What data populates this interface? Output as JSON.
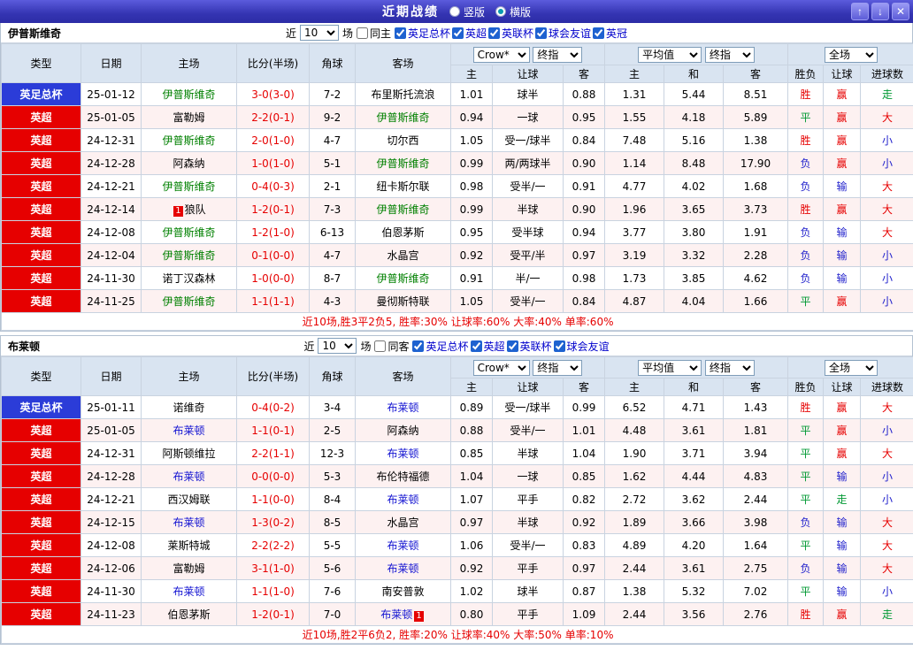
{
  "window": {
    "title": "近期战绩",
    "layout_radios": {
      "vertical": "竖版",
      "horizontal": "横版",
      "selected": "横版"
    }
  },
  "icons": {
    "up": "↑",
    "down": "↓",
    "close": "✕"
  },
  "filter_labels": {
    "near": "近",
    "games": "场"
  },
  "columns": {
    "type": "类型",
    "date": "日期",
    "home": "主场",
    "score": "比分(半场)",
    "corner": "角球",
    "away": "客场",
    "odds_home": "主",
    "handicap": "让球",
    "odds_away": "客",
    "avg_home": "主",
    "avg_draw": "和",
    "avg_away": "客",
    "result": "胜负",
    "handicap_result": "让球",
    "goals": "进球数"
  },
  "selects": {
    "bookmaker": "Crow*",
    "odds_time": "终指",
    "average": "平均值",
    "avg_time": "终指",
    "scope": "全场"
  },
  "type_colors": {
    "英足总杯": "#2b3cd8",
    "英超": "#e60000"
  },
  "result_colors": {
    "胜": "#e60000",
    "赢": "#e60000",
    "大": "#e60000",
    "平": "#009933",
    "走": "#009933",
    "负": "#2222cc",
    "输": "#2222cc",
    "小": "#2222cc"
  },
  "sections": [
    {
      "team": "伊普斯维奇",
      "team_color": "#008000",
      "count": "10",
      "same_label": "同主",
      "leagues": [
        "英足总杯",
        "英超",
        "英联杯",
        "球会友谊",
        "英冠"
      ],
      "summary": "近10场,胜3平2负5, 胜率:30% 让球率:60% 大率:40% 单率:60%",
      "rows": [
        {
          "type": "英足总杯",
          "date": "25-01-12",
          "home": "伊普斯维奇",
          "home_is_team": true,
          "score": "3-0(3-0)",
          "corner": "7-2",
          "away": "布里斯托流浪",
          "odds_home": "1.01",
          "handicap": "球半",
          "odds_away": "0.88",
          "avg_home": "1.31",
          "avg_draw": "5.44",
          "avg_away": "8.51",
          "result": "胜",
          "handicap_result": "赢",
          "goals_result": "走"
        },
        {
          "type": "英超",
          "date": "25-01-05",
          "home": "富勒姆",
          "score": "2-2(0-1)",
          "corner": "9-2",
          "away": "伊普斯维奇",
          "away_is_team": true,
          "odds_home": "0.94",
          "handicap": "一球",
          "odds_away": "0.95",
          "avg_home": "1.55",
          "avg_draw": "4.18",
          "avg_away": "5.89",
          "result": "平",
          "handicap_result": "赢",
          "goals_result": "大"
        },
        {
          "type": "英超",
          "date": "24-12-31",
          "home": "伊普斯维奇",
          "home_is_team": true,
          "score": "2-0(1-0)",
          "corner": "4-7",
          "away": "切尔西",
          "odds_home": "1.05",
          "handicap": "受一/球半",
          "odds_away": "0.84",
          "avg_home": "7.48",
          "avg_draw": "5.16",
          "avg_away": "1.38",
          "result": "胜",
          "handicap_result": "赢",
          "goals_result": "小"
        },
        {
          "type": "英超",
          "date": "24-12-28",
          "home": "阿森纳",
          "score": "1-0(1-0)",
          "corner": "5-1",
          "away": "伊普斯维奇",
          "away_is_team": true,
          "odds_home": "0.99",
          "handicap": "两/两球半",
          "odds_away": "0.90",
          "avg_home": "1.14",
          "avg_draw": "8.48",
          "avg_away": "17.90",
          "result": "负",
          "handicap_result": "赢",
          "goals_result": "小"
        },
        {
          "type": "英超",
          "date": "24-12-21",
          "home": "伊普斯维奇",
          "home_is_team": true,
          "score": "0-4(0-3)",
          "corner": "2-1",
          "away": "纽卡斯尔联",
          "odds_home": "0.98",
          "handicap": "受半/一",
          "odds_away": "0.91",
          "avg_home": "4.77",
          "avg_draw": "4.02",
          "avg_away": "1.68",
          "result": "负",
          "handicap_result": "输",
          "goals_result": "大"
        },
        {
          "type": "英超",
          "date": "24-12-14",
          "home": "狼队",
          "home_badge": "1",
          "score": "1-2(0-1)",
          "corner": "7-3",
          "away": "伊普斯维奇",
          "away_is_team": true,
          "odds_home": "0.99",
          "handicap": "半球",
          "odds_away": "0.90",
          "avg_home": "1.96",
          "avg_draw": "3.65",
          "avg_away": "3.73",
          "result": "胜",
          "handicap_result": "赢",
          "goals_result": "大"
        },
        {
          "type": "英超",
          "date": "24-12-08",
          "home": "伊普斯维奇",
          "home_is_team": true,
          "score": "1-2(1-0)",
          "corner": "6-13",
          "away": "伯恩茅斯",
          "odds_home": "0.95",
          "handicap": "受半球",
          "odds_away": "0.94",
          "avg_home": "3.77",
          "avg_draw": "3.80",
          "avg_away": "1.91",
          "result": "负",
          "handicap_result": "输",
          "goals_result": "大"
        },
        {
          "type": "英超",
          "date": "24-12-04",
          "home": "伊普斯维奇",
          "home_is_team": true,
          "score": "0-1(0-0)",
          "corner": "4-7",
          "away": "水晶宫",
          "odds_home": "0.92",
          "handicap": "受平/半",
          "odds_away": "0.97",
          "avg_home": "3.19",
          "avg_draw": "3.32",
          "avg_away": "2.28",
          "result": "负",
          "handicap_result": "输",
          "goals_result": "小"
        },
        {
          "type": "英超",
          "date": "24-11-30",
          "home": "诺丁汉森林",
          "score": "1-0(0-0)",
          "corner": "8-7",
          "away": "伊普斯维奇",
          "away_is_team": true,
          "odds_home": "0.91",
          "handicap": "半/一",
          "odds_away": "0.98",
          "avg_home": "1.73",
          "avg_draw": "3.85",
          "avg_away": "4.62",
          "result": "负",
          "handicap_result": "输",
          "goals_result": "小"
        },
        {
          "type": "英超",
          "date": "24-11-25",
          "home": "伊普斯维奇",
          "home_is_team": true,
          "score": "1-1(1-1)",
          "corner": "4-3",
          "away": "曼彻斯特联",
          "odds_home": "1.05",
          "handicap": "受半/一",
          "odds_away": "0.84",
          "avg_home": "4.87",
          "avg_draw": "4.04",
          "avg_away": "1.66",
          "result": "平",
          "handicap_result": "赢",
          "goals_result": "小"
        }
      ]
    },
    {
      "team": "布莱顿",
      "team_color": "#1414d2",
      "count": "10",
      "same_label": "同客",
      "leagues": [
        "英足总杯",
        "英超",
        "英联杯",
        "球会友谊"
      ],
      "summary": "近10场,胜2平6负2, 胜率:20% 让球率:40% 大率:50% 单率:10%",
      "rows": [
        {
          "type": "英足总杯",
          "date": "25-01-11",
          "home": "诺维奇",
          "score": "0-4(0-2)",
          "corner": "3-4",
          "away": "布莱顿",
          "away_is_team": true,
          "odds_home": "0.89",
          "handicap": "受一/球半",
          "odds_away": "0.99",
          "avg_home": "6.52",
          "avg_draw": "4.71",
          "avg_away": "1.43",
          "result": "胜",
          "handicap_result": "赢",
          "goals_result": "大"
        },
        {
          "type": "英超",
          "date": "25-01-05",
          "home": "布莱顿",
          "home_is_team": true,
          "score": "1-1(0-1)",
          "corner": "2-5",
          "away": "阿森纳",
          "odds_home": "0.88",
          "handicap": "受半/一",
          "odds_away": "1.01",
          "avg_home": "4.48",
          "avg_draw": "3.61",
          "avg_away": "1.81",
          "result": "平",
          "handicap_result": "赢",
          "goals_result": "小"
        },
        {
          "type": "英超",
          "date": "24-12-31",
          "home": "阿斯顿维拉",
          "score": "2-2(1-1)",
          "corner": "12-3",
          "away": "布莱顿",
          "away_is_team": true,
          "odds_home": "0.85",
          "handicap": "半球",
          "odds_away": "1.04",
          "avg_home": "1.90",
          "avg_draw": "3.71",
          "avg_away": "3.94",
          "result": "平",
          "handicap_result": "赢",
          "goals_result": "大"
        },
        {
          "type": "英超",
          "date": "24-12-28",
          "home": "布莱顿",
          "home_is_team": true,
          "score": "0-0(0-0)",
          "corner": "5-3",
          "away": "布伦特福德",
          "odds_home": "1.04",
          "handicap": "一球",
          "odds_away": "0.85",
          "avg_home": "1.62",
          "avg_draw": "4.44",
          "avg_away": "4.83",
          "result": "平",
          "handicap_result": "输",
          "goals_result": "小"
        },
        {
          "type": "英超",
          "date": "24-12-21",
          "home": "西汉姆联",
          "score": "1-1(0-0)",
          "corner": "8-4",
          "away": "布莱顿",
          "away_is_team": true,
          "odds_home": "1.07",
          "handicap": "平手",
          "odds_away": "0.82",
          "avg_home": "2.72",
          "avg_draw": "3.62",
          "avg_away": "2.44",
          "result": "平",
          "handicap_result": "走",
          "goals_result": "小"
        },
        {
          "type": "英超",
          "date": "24-12-15",
          "home": "布莱顿",
          "home_is_team": true,
          "score": "1-3(0-2)",
          "corner": "8-5",
          "away": "水晶宫",
          "odds_home": "0.97",
          "handicap": "半球",
          "odds_away": "0.92",
          "avg_home": "1.89",
          "avg_draw": "3.66",
          "avg_away": "3.98",
          "result": "负",
          "handicap_result": "输",
          "goals_result": "大"
        },
        {
          "type": "英超",
          "date": "24-12-08",
          "home": "莱斯特城",
          "score": "2-2(2-2)",
          "corner": "5-5",
          "away": "布莱顿",
          "away_is_team": true,
          "odds_home": "1.06",
          "handicap": "受半/一",
          "odds_away": "0.83",
          "avg_home": "4.89",
          "avg_draw": "4.20",
          "avg_away": "1.64",
          "result": "平",
          "handicap_result": "输",
          "goals_result": "大"
        },
        {
          "type": "英超",
          "date": "24-12-06",
          "home": "富勒姆",
          "score": "3-1(1-0)",
          "corner": "5-6",
          "away": "布莱顿",
          "away_is_team": true,
          "odds_home": "0.92",
          "handicap": "平手",
          "odds_away": "0.97",
          "avg_home": "2.44",
          "avg_draw": "3.61",
          "avg_away": "2.75",
          "result": "负",
          "handicap_result": "输",
          "goals_result": "大"
        },
        {
          "type": "英超",
          "date": "24-11-30",
          "home": "布莱顿",
          "home_is_team": true,
          "score": "1-1(1-0)",
          "corner": "7-6",
          "away": "南安普敦",
          "odds_home": "1.02",
          "handicap": "球半",
          "odds_away": "0.87",
          "avg_home": "1.38",
          "avg_draw": "5.32",
          "avg_away": "7.02",
          "result": "平",
          "handicap_result": "输",
          "goals_result": "小"
        },
        {
          "type": "英超",
          "date": "24-11-23",
          "home": "伯恩茅斯",
          "score": "1-2(0-1)",
          "corner": "7-0",
          "away": "布莱顿",
          "away_is_team": true,
          "away_badge": "1",
          "odds_home": "0.80",
          "handicap": "平手",
          "odds_away": "1.09",
          "avg_home": "2.44",
          "avg_draw": "3.56",
          "avg_away": "2.76",
          "result": "胜",
          "handicap_result": "赢",
          "goals_result": "走"
        }
      ]
    }
  ]
}
